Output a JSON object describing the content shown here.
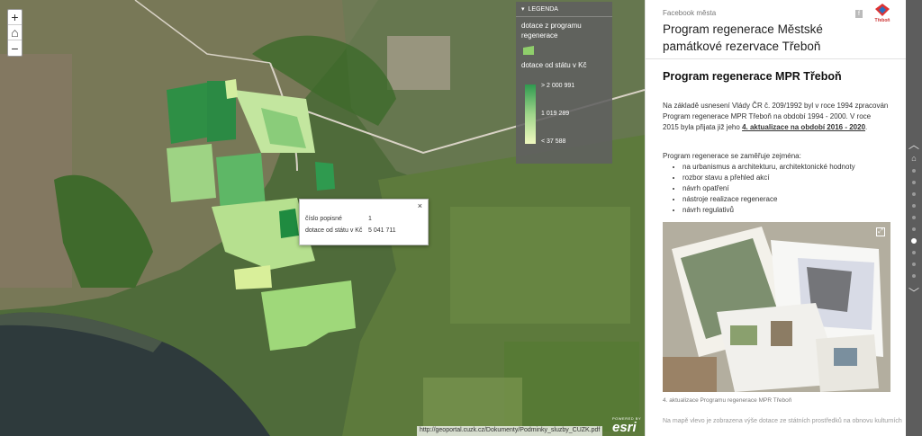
{
  "map": {
    "zoom_in": "+",
    "home": "⌂",
    "zoom_out": "−",
    "attribution": "http://geoportal.cuzk.cz/Dokumenty/Podminky_sluzby_CUZK.pdf",
    "powered_by": "POWERED BY",
    "esri": "esri"
  },
  "legend": {
    "header": "LEGENDA",
    "layer_title": "dotace z programu regenerace",
    "field_title": "dotace od státu v Kč",
    "max_label": "> 2 000 991",
    "mid_label": "1 019 289",
    "min_label": "< 37 588",
    "ramp_colors": [
      "#2f9a4f",
      "#9fd58a",
      "#eff8bf"
    ]
  },
  "popup": {
    "close": "×",
    "rows": [
      {
        "label": "číslo popisné",
        "value": "1"
      },
      {
        "label": "dotace od státu v Kč",
        "value": "5 041 711"
      }
    ]
  },
  "panel": {
    "facebook_label": "Facebook města",
    "title": "Program regenerace Městské památkové rezervace Třeboň",
    "logo_text": "Třeboň",
    "heading": "Program regenerace MPR Třeboň",
    "para_before_link": "Na základě usnesení Vlády ČR č. 209/1992 byl v roce 1994 zpracován Program regenerace MPR Třeboň na období 1994 - 2000. V roce 2015 byla přijata již jeho ",
    "para_link": "4. aktualizace na období 2016 - 2020",
    "para_after_link": ".",
    "list_intro": "Program regenerace se zaměřuje zejména:",
    "list_items": [
      "na urbanismus a architekturu, architektonické hodnoty",
      "rozbor stavu a přehled akcí",
      "návrh opatření",
      "nástroje realizace regenerace",
      "návrh regulativů"
    ],
    "photo_caption": "4. aktualizace Programu regenerace MPR Třeboň",
    "cut_text": "Na mapě vlevo je zobrazena výše dotace ze státních prostředků na obnovu kulturních"
  }
}
